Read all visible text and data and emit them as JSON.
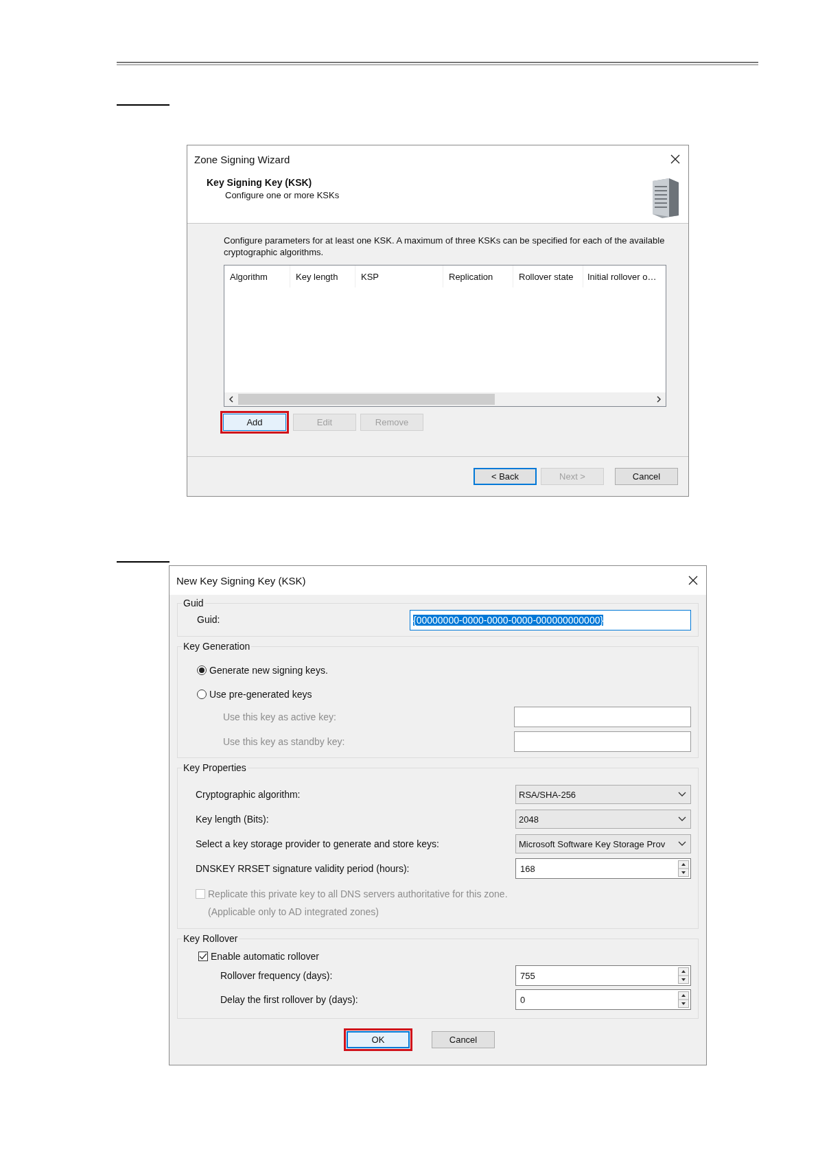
{
  "wizard": {
    "title": "Zone Signing Wizard",
    "header": {
      "title": "Key Signing Key (KSK)",
      "subtitle": "Configure one or more KSKs"
    },
    "description": "Configure parameters for at least one KSK. A maximum of three KSKs can be specified for each of the available cryptographic algorithms.",
    "columns": [
      "Algorithm",
      "Key length",
      "KSP",
      "Replication",
      "Rollover state",
      "Initial rollover o…"
    ],
    "buttons": [
      {
        "label": "Add",
        "disabled": false,
        "highlighted": true
      },
      {
        "label": "Edit",
        "disabled": true,
        "highlighted": false
      },
      {
        "label": "Remove",
        "disabled": true,
        "highlighted": false
      }
    ],
    "footer_buttons": [
      {
        "label": "< Back",
        "disabled": false,
        "default": true
      },
      {
        "label": "Next >",
        "disabled": true,
        "default": false
      },
      {
        "label": "Cancel",
        "disabled": false,
        "default": false
      }
    ]
  },
  "dialog": {
    "title": "New Key Signing Key (KSK)",
    "guid": {
      "legend": "Guid",
      "label": "Guid:",
      "value": "{00000000-0000-0000-0000-000000000000}",
      "selected": true
    },
    "key_generation": {
      "legend": "Key Generation",
      "options": [
        {
          "label": "Generate new signing keys.",
          "selected": true
        },
        {
          "label": "Use pre-generated keys",
          "selected": false
        }
      ],
      "fields": [
        {
          "label": "Use this key as active key:",
          "disabled": true
        },
        {
          "label": "Use this key as standby key:",
          "disabled": true
        }
      ]
    },
    "key_properties": {
      "legend": "Key Properties",
      "fields": [
        {
          "kind": "dropdown",
          "label": "Cryptographic algorithm:",
          "value": "RSA/SHA-256"
        },
        {
          "kind": "dropdown",
          "label": "Key length (Bits):",
          "value": "2048"
        },
        {
          "kind": "dropdown",
          "label": "Select a key storage provider to generate and store keys:",
          "value": "Microsoft Software Key Storage Prov"
        },
        {
          "kind": "spinner",
          "label": "DNSKEY RRSET signature validity period (hours):",
          "value": "168"
        }
      ],
      "replicate": {
        "label": "Replicate this private key to all DNS servers authoritative for this zone.",
        "checked": false,
        "disabled": true
      },
      "note": "(Applicable only to AD integrated zones)"
    },
    "key_rollover": {
      "legend": "Key Rollover",
      "enable": {
        "label": "Enable automatic rollover",
        "checked": true
      },
      "fields": [
        {
          "label": "Rollover frequency (days):",
          "value": "755"
        },
        {
          "label": "Delay the first rollover by (days):",
          "value": "0"
        }
      ]
    },
    "buttons": [
      {
        "label": "OK",
        "default": true,
        "highlighted": true
      },
      {
        "label": "Cancel",
        "default": false,
        "highlighted": false
      }
    ]
  }
}
